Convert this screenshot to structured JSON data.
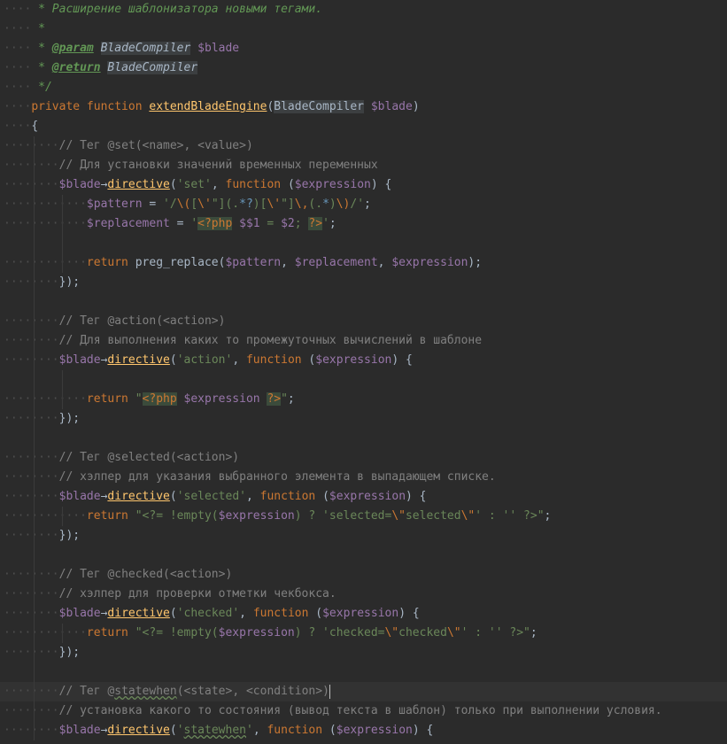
{
  "editor": {
    "language": "php",
    "theme": "darcula",
    "colors": {
      "background": "#2b2b2b",
      "current_line": "#323232",
      "keyword": "#cc7832",
      "variable": "#9876aa",
      "function": "#ffc66d",
      "string": "#6a8759",
      "comment": "#808080",
      "doc_comment": "#629755"
    },
    "lines": [
      {
        "indent": 1,
        "tokens": [
          [
            "doc",
            " * Расширение шаблонизатора новыми тегами."
          ]
        ]
      },
      {
        "indent": 1,
        "tokens": [
          [
            "doc",
            " *"
          ]
        ]
      },
      {
        "indent": 1,
        "tokens": [
          [
            "doc",
            " * "
          ],
          [
            "tag",
            "@param"
          ],
          [
            "doc",
            " "
          ],
          [
            "doctype",
            "BladeCompiler"
          ],
          [
            "doc",
            " "
          ],
          [
            "var",
            "$blade"
          ]
        ]
      },
      {
        "indent": 1,
        "tokens": [
          [
            "doc",
            " * "
          ],
          [
            "tag",
            "@return"
          ],
          [
            "doc",
            " "
          ],
          [
            "doctype",
            "BladeCompiler"
          ]
        ]
      },
      {
        "indent": 1,
        "tokens": [
          [
            "doc",
            " */"
          ]
        ]
      },
      {
        "indent": 1,
        "tokens": [
          [
            "kw",
            "private function "
          ],
          [
            "fn-u",
            "extendBladeEngine"
          ],
          [
            "plain",
            "("
          ],
          [
            "type-bg",
            "BladeCompiler"
          ],
          [
            "plain",
            " "
          ],
          [
            "var",
            "$blade"
          ],
          [
            "plain",
            ")"
          ]
        ]
      },
      {
        "indent": 1,
        "tokens": [
          [
            "plain",
            "{"
          ]
        ]
      },
      {
        "indent": 2,
        "tokens": [
          [
            "cmt",
            "// Тег @set(<name>, <value>)"
          ]
        ]
      },
      {
        "indent": 2,
        "tokens": [
          [
            "cmt",
            "// Для установки значений временных переменных"
          ]
        ]
      },
      {
        "indent": 2,
        "tokens": [
          [
            "var",
            "$blade"
          ],
          [
            "arrow",
            "→"
          ],
          [
            "fn-u",
            "directive"
          ],
          [
            "plain",
            "("
          ],
          [
            "str",
            "'set'"
          ],
          [
            "plain",
            ", "
          ],
          [
            "kw",
            "function"
          ],
          [
            "plain",
            " ("
          ],
          [
            "var",
            "$expression"
          ],
          [
            "plain",
            ") {"
          ]
        ]
      },
      {
        "indent": 3,
        "tokens": [
          [
            "var",
            "$pattern"
          ],
          [
            "plain",
            " = "
          ],
          [
            "str",
            "'/"
          ],
          [
            "esc",
            "\\("
          ],
          [
            "str",
            "["
          ],
          [
            "esc",
            "\\'"
          ],
          [
            "str",
            "\"](."
          ],
          [
            "rx",
            "*?"
          ],
          [
            "str",
            ")["
          ],
          [
            "esc",
            "\\'"
          ],
          [
            "str",
            "\"]"
          ],
          [
            "esc",
            "\\,"
          ],
          [
            "str",
            "(."
          ],
          [
            "rx",
            "*"
          ],
          [
            "str",
            ")"
          ],
          [
            "esc",
            "\\)"
          ],
          [
            "str",
            "/'"
          ],
          [
            "plain",
            ";"
          ]
        ]
      },
      {
        "indent": 3,
        "tokens": [
          [
            "var",
            "$replacement"
          ],
          [
            "plain",
            " = "
          ],
          [
            "str",
            "'"
          ],
          [
            "php-tag",
            "<?php"
          ],
          [
            "str",
            " "
          ],
          [
            "var",
            "$$1"
          ],
          [
            "str",
            " = "
          ],
          [
            "var",
            "$2"
          ],
          [
            "str",
            "; "
          ],
          [
            "php-tag",
            "?>"
          ],
          [
            "str",
            "'"
          ],
          [
            "plain",
            ";"
          ]
        ]
      },
      {
        "indent": 0,
        "tokens": []
      },
      {
        "indent": 3,
        "tokens": [
          [
            "kw",
            "return "
          ],
          [
            "plain",
            "preg_replace("
          ],
          [
            "var",
            "$pattern"
          ],
          [
            "plain",
            ", "
          ],
          [
            "var",
            "$replacement"
          ],
          [
            "plain",
            ", "
          ],
          [
            "var",
            "$expression"
          ],
          [
            "plain",
            ");"
          ]
        ]
      },
      {
        "indent": 2,
        "tokens": [
          [
            "plain",
            "});"
          ]
        ]
      },
      {
        "indent": 0,
        "tokens": []
      },
      {
        "indent": 2,
        "tokens": [
          [
            "cmt",
            "// Тег @action(<action>)"
          ]
        ]
      },
      {
        "indent": 2,
        "tokens": [
          [
            "cmt",
            "// Для выполнения каких то промежуточных вычислений в шаблоне"
          ]
        ]
      },
      {
        "indent": 2,
        "tokens": [
          [
            "var",
            "$blade"
          ],
          [
            "arrow",
            "→"
          ],
          [
            "fn-u",
            "directive"
          ],
          [
            "plain",
            "("
          ],
          [
            "str",
            "'action'"
          ],
          [
            "plain",
            ", "
          ],
          [
            "kw",
            "function"
          ],
          [
            "plain",
            " ("
          ],
          [
            "var",
            "$expression"
          ],
          [
            "plain",
            ") {"
          ]
        ]
      },
      {
        "indent": 0,
        "tokens": []
      },
      {
        "indent": 3,
        "tokens": [
          [
            "kw",
            "return "
          ],
          [
            "str",
            "\""
          ],
          [
            "php-tag",
            "<?php"
          ],
          [
            "str",
            " "
          ],
          [
            "var",
            "$expression"
          ],
          [
            "str",
            " "
          ],
          [
            "php-tag",
            "?>"
          ],
          [
            "str",
            "\""
          ],
          [
            "plain",
            ";"
          ]
        ]
      },
      {
        "indent": 2,
        "tokens": [
          [
            "plain",
            "});"
          ]
        ]
      },
      {
        "indent": 0,
        "tokens": []
      },
      {
        "indent": 2,
        "tokens": [
          [
            "cmt",
            "// Тег @selected(<action>)"
          ]
        ]
      },
      {
        "indent": 2,
        "tokens": [
          [
            "cmt",
            "// хэлпер для указания выбранного элемента в выпадающем списке."
          ]
        ]
      },
      {
        "indent": 2,
        "tokens": [
          [
            "var",
            "$blade"
          ],
          [
            "arrow",
            "→"
          ],
          [
            "fn-u",
            "directive"
          ],
          [
            "plain",
            "("
          ],
          [
            "str",
            "'selected'"
          ],
          [
            "plain",
            ", "
          ],
          [
            "kw",
            "function"
          ],
          [
            "plain",
            " ("
          ],
          [
            "var",
            "$expression"
          ],
          [
            "plain",
            ") {"
          ]
        ]
      },
      {
        "indent": 3,
        "tokens": [
          [
            "kw",
            "return "
          ],
          [
            "str",
            "\"<?= !empty("
          ],
          [
            "var",
            "$expression"
          ],
          [
            "str",
            ") ? 'selected="
          ],
          [
            "esc",
            "\\\""
          ],
          [
            "str",
            "selected"
          ],
          [
            "esc",
            "\\\""
          ],
          [
            "str",
            "' : '' ?>\""
          ],
          [
            "plain",
            ";"
          ]
        ]
      },
      {
        "indent": 2,
        "tokens": [
          [
            "plain",
            "});"
          ]
        ]
      },
      {
        "indent": 0,
        "tokens": []
      },
      {
        "indent": 2,
        "tokens": [
          [
            "cmt",
            "// Тег @checked(<action>)"
          ]
        ]
      },
      {
        "indent": 2,
        "tokens": [
          [
            "cmt",
            "// хэлпер для проверки отметки чекбокса."
          ]
        ]
      },
      {
        "indent": 2,
        "tokens": [
          [
            "var",
            "$blade"
          ],
          [
            "arrow",
            "→"
          ],
          [
            "fn-u",
            "directive"
          ],
          [
            "plain",
            "("
          ],
          [
            "str",
            "'checked'"
          ],
          [
            "plain",
            ", "
          ],
          [
            "kw",
            "function"
          ],
          [
            "plain",
            " ("
          ],
          [
            "var",
            "$expression"
          ],
          [
            "plain",
            ") {"
          ]
        ]
      },
      {
        "indent": 3,
        "tokens": [
          [
            "kw",
            "return "
          ],
          [
            "str",
            "\"<?= !empty("
          ],
          [
            "var",
            "$expression"
          ],
          [
            "str",
            ") ? 'checked="
          ],
          [
            "esc",
            "\\\""
          ],
          [
            "str",
            "checked"
          ],
          [
            "esc",
            "\\\""
          ],
          [
            "str",
            "' : '' ?>\""
          ],
          [
            "plain",
            ";"
          ]
        ]
      },
      {
        "indent": 2,
        "tokens": [
          [
            "plain",
            "});"
          ]
        ]
      },
      {
        "indent": 0,
        "tokens": []
      },
      {
        "indent": 2,
        "current": true,
        "tokens": [
          [
            "cmt",
            "// Тег @"
          ],
          [
            "cmt-u",
            "statewhen"
          ],
          [
            "cmt",
            "(<state>, <condition>)"
          ]
        ]
      },
      {
        "indent": 2,
        "tokens": [
          [
            "cmt",
            "// установка какого то состояния (вывод текста в шаблон) только при выполнении условия."
          ]
        ]
      },
      {
        "indent": 2,
        "tokens": [
          [
            "var",
            "$blade"
          ],
          [
            "arrow",
            "→"
          ],
          [
            "fn-u",
            "directive"
          ],
          [
            "plain",
            "("
          ],
          [
            "str",
            "'"
          ],
          [
            "str-u",
            "statewhen"
          ],
          [
            "str",
            "'"
          ],
          [
            "plain",
            ", "
          ],
          [
            "kw",
            "function"
          ],
          [
            "plain",
            " ("
          ],
          [
            "var",
            "$expression"
          ],
          [
            "plain",
            ") {"
          ]
        ]
      }
    ]
  }
}
